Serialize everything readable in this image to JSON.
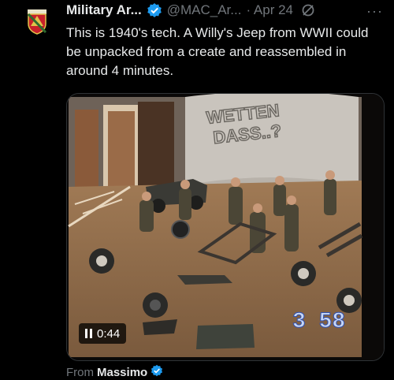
{
  "post": {
    "display_name": "Military Ar...",
    "handle": "@MAC_Ar...",
    "date": "· Apr 24",
    "more_icon": "more-horizontal-icon",
    "text": "This is 1940's tech. A Willy's Jeep from WWII could be unpacked from a create and reassembled in around 4 minutes."
  },
  "video": {
    "elapsed": "0:44",
    "scoreboard": "3 58",
    "set_sign": "WETTEN DASS..?",
    "state_icon": "pause-icon"
  },
  "attribution": {
    "prefix": "From",
    "name": "Massimo"
  },
  "colors": {
    "verified": "#1d9bf0",
    "background": "#000000",
    "secondary_text": "#71767b"
  }
}
